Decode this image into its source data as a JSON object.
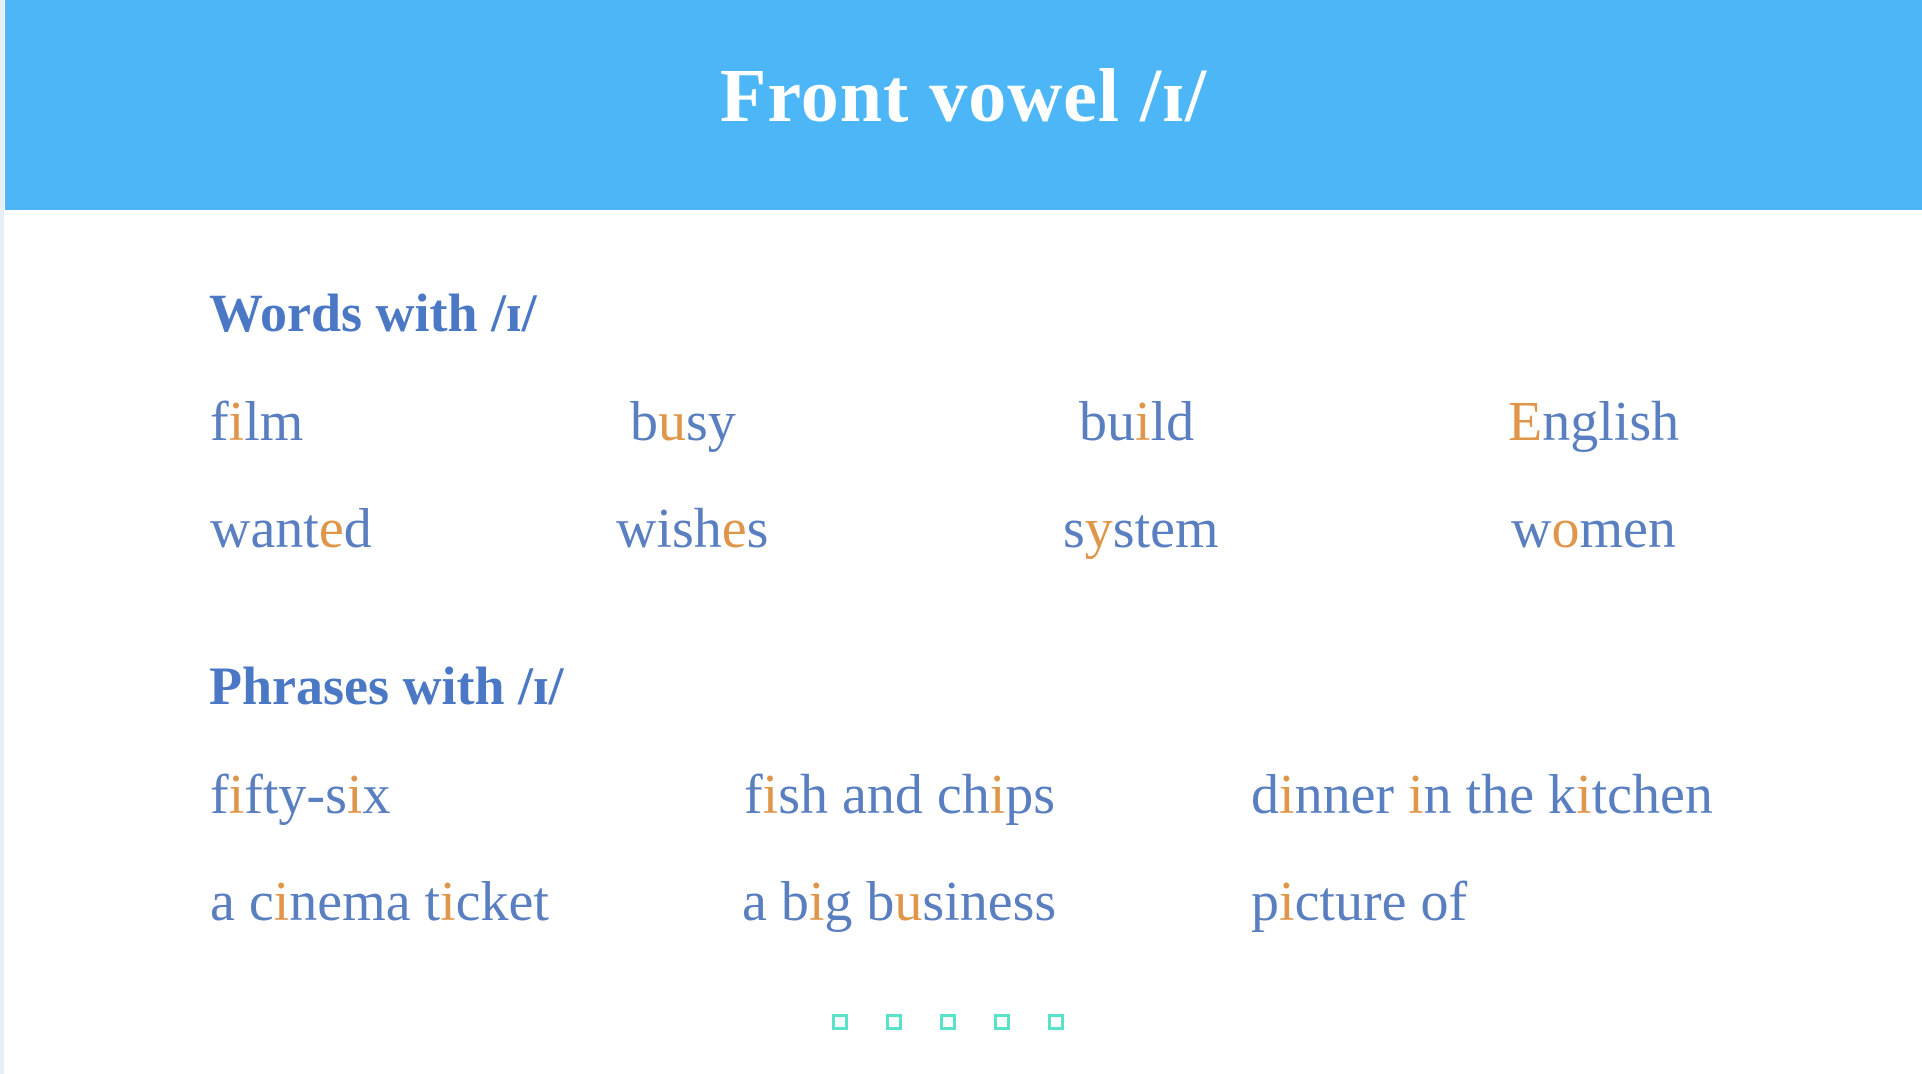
{
  "colors": {
    "header_bg": "#4db6f6",
    "heading_text": "#4b78c4",
    "word_text": "#5a7fc0",
    "highlight": "#e0964a",
    "nav_dot": "#58e2c8"
  },
  "header": {
    "title": "Front vowel /ɪ/"
  },
  "words_section": {
    "heading": "Words with /ɪ/",
    "items": [
      {
        "segments": [
          {
            "t": "f",
            "h": false
          },
          {
            "t": "i",
            "h": true
          },
          {
            "t": "lm",
            "h": false
          }
        ]
      },
      {
        "segments": [
          {
            "t": "b",
            "h": false
          },
          {
            "t": "u",
            "h": true
          },
          {
            "t": "sy",
            "h": false
          }
        ]
      },
      {
        "segments": [
          {
            "t": "bu",
            "h": false
          },
          {
            "t": "i",
            "h": true
          },
          {
            "t": "ld",
            "h": false
          }
        ]
      },
      {
        "segments": [
          {
            "t": "E",
            "h": true
          },
          {
            "t": "nglish",
            "h": false
          }
        ]
      },
      {
        "segments": [
          {
            "t": "want",
            "h": false
          },
          {
            "t": "e",
            "h": true
          },
          {
            "t": "d",
            "h": false
          }
        ]
      },
      {
        "segments": [
          {
            "t": "wish",
            "h": false
          },
          {
            "t": "e",
            "h": true
          },
          {
            "t": "s",
            "h": false
          }
        ]
      },
      {
        "segments": [
          {
            "t": "s",
            "h": false
          },
          {
            "t": "y",
            "h": true
          },
          {
            "t": "stem",
            "h": false
          }
        ]
      },
      {
        "segments": [
          {
            "t": "w",
            "h": false
          },
          {
            "t": "o",
            "h": true
          },
          {
            "t": "men",
            "h": false
          }
        ]
      }
    ]
  },
  "phrases_section": {
    "heading": "Phrases with /ɪ/",
    "items": [
      {
        "segments": [
          {
            "t": "f",
            "h": false
          },
          {
            "t": "i",
            "h": true
          },
          {
            "t": "fty-s",
            "h": false
          },
          {
            "t": "i",
            "h": true
          },
          {
            "t": "x",
            "h": false
          }
        ]
      },
      {
        "segments": [
          {
            "t": "f",
            "h": false
          },
          {
            "t": "i",
            "h": true
          },
          {
            "t": "sh and ch",
            "h": false
          },
          {
            "t": "i",
            "h": true
          },
          {
            "t": "ps",
            "h": false
          }
        ]
      },
      {
        "segments": [
          {
            "t": "d",
            "h": false
          },
          {
            "t": "i",
            "h": true
          },
          {
            "t": "nner ",
            "h": false
          },
          {
            "t": "i",
            "h": true
          },
          {
            "t": "n the k",
            "h": false
          },
          {
            "t": "i",
            "h": true
          },
          {
            "t": "tchen",
            "h": false
          }
        ]
      },
      {
        "segments": [
          {
            "t": "a c",
            "h": false
          },
          {
            "t": "i",
            "h": true
          },
          {
            "t": "nema t",
            "h": false
          },
          {
            "t": "i",
            "h": true
          },
          {
            "t": "cket",
            "h": false
          }
        ]
      },
      {
        "segments": [
          {
            "t": "a b",
            "h": false
          },
          {
            "t": "i",
            "h": true
          },
          {
            "t": "g b",
            "h": false
          },
          {
            "t": "u",
            "h": true
          },
          {
            "t": "siness",
            "h": false
          }
        ]
      },
      {
        "segments": [
          {
            "t": "p",
            "h": false
          },
          {
            "t": "i",
            "h": true
          },
          {
            "t": "cture of",
            "h": false
          }
        ]
      }
    ]
  },
  "navigation": {
    "dot_count": 5
  }
}
